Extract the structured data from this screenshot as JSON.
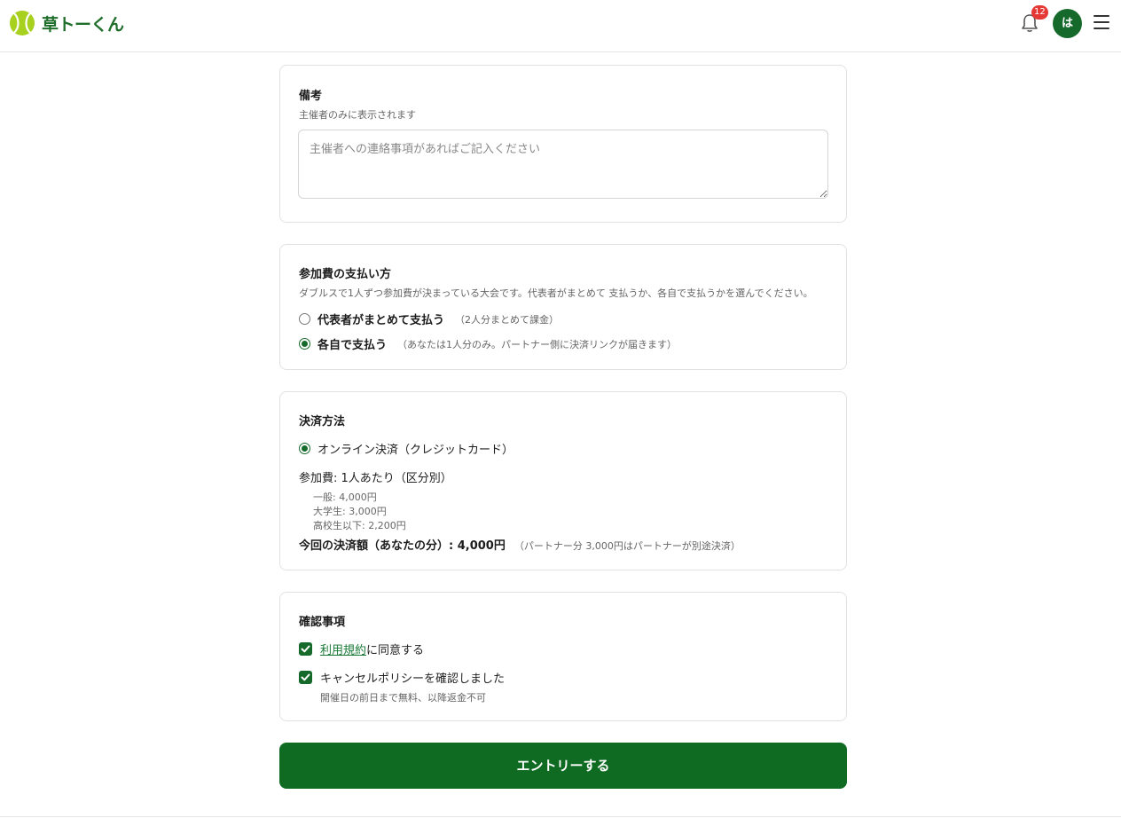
{
  "header": {
    "logo_text": "草トーくん",
    "notification_count": "12",
    "avatar_initial": "は"
  },
  "notes": {
    "title": "備考",
    "subtitle": "主催者のみに表示されます",
    "placeholder": "主催者への連絡事項があればご記入ください"
  },
  "payment_split": {
    "title": "参加費の支払い方",
    "description": "ダブルスで1人ずつ参加費が決まっている大会です。代表者がまとめて 支払うか、各自で支払うかを選んでください。",
    "options": [
      {
        "label": "代表者がまとめて支払う",
        "note": "（2人分まとめて課金）",
        "selected": false
      },
      {
        "label": "各自で支払う",
        "note": "（あなたは1人分のみ。パートナー側に決済リンクが届きます）",
        "selected": true
      }
    ]
  },
  "payment_method": {
    "title": "決済方法",
    "option_label": "オンライン決済（クレジットカード）",
    "fee_heading": "参加費: 1人あたり（区分別）",
    "fees": [
      "一般: 4,000円",
      "大学生: 3,000円",
      "高校生以下: 2,200円"
    ],
    "total_label": "今回の決済額（あなたの分）: 4,000円",
    "total_note": "（パートナー分 3,000円はパートナーが別途決済）"
  },
  "confirm": {
    "title": "確認事項",
    "terms_link": "利用規約",
    "terms_suffix": "に同意する",
    "cancel_label": "キャンセルポリシーを確認しました",
    "cancel_note": "開催日の前日まで無料、以降返金不可"
  },
  "submit_label": "エントリーする",
  "colors": {
    "brand": "#15692a",
    "badge": "#e53935",
    "button": "#0f6b21"
  }
}
